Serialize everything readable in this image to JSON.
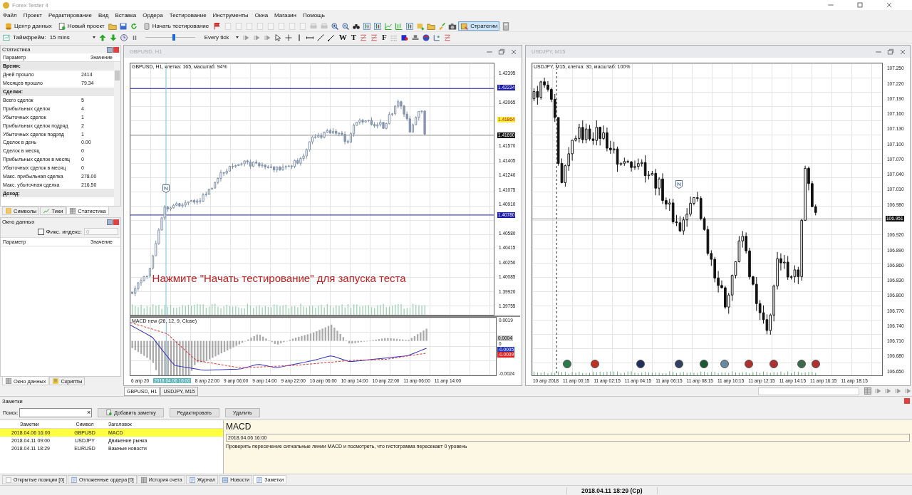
{
  "window": {
    "title": "Forex Tester 4"
  },
  "menu": [
    "Файл",
    "Проект",
    "Редактирование",
    "Вид",
    "Вставка",
    "Ордера",
    "Тестирование",
    "Инструменты",
    "Окна",
    "Магазин",
    "Помощь"
  ],
  "toolbar1": {
    "data_center": "Центр данных",
    "new_project": "Новый проект",
    "start_testing": "Начать тестирование",
    "strategies": {
      "label": "Стратегии",
      "pressed": true
    }
  },
  "toolbar2": {
    "timeframe_label": "Таймфрейм:",
    "timeframe": "15 mins",
    "speed": {
      "level": 0.58
    },
    "tick_mode": "Every tick",
    "glyph_tools": [
      "W",
      "T"
    ],
    "font_button": "F"
  },
  "statistics": {
    "title": "Статистика",
    "columns": [
      "Параметр",
      "Значение"
    ],
    "rows": [
      {
        "kind": "section",
        "label": "Время:"
      },
      {
        "kind": "row",
        "label": "Дней прошло",
        "value": "2414"
      },
      {
        "kind": "row",
        "label": "Месяцев прошло",
        "value": "79.34"
      },
      {
        "kind": "section",
        "label": "Сделки:"
      },
      {
        "kind": "row",
        "label": "Всего сделок",
        "value": "5"
      },
      {
        "kind": "row",
        "label": "Прибыльных сделок",
        "value": "4"
      },
      {
        "kind": "row",
        "label": "Убыточных сделок",
        "value": "1"
      },
      {
        "kind": "row",
        "label": "Прибыльных сделок подряд",
        "value": "2"
      },
      {
        "kind": "row",
        "label": "Убыточных сделок подряд",
        "value": "1"
      },
      {
        "kind": "row",
        "label": "Сделок в день",
        "value": "0.00"
      },
      {
        "kind": "row",
        "label": "Сделок в месяц",
        "value": "0"
      },
      {
        "kind": "row",
        "label": "Прибыльных сделок в месяц",
        "value": "0"
      },
      {
        "kind": "row",
        "label": "Убыточных сделок в месяц",
        "value": "0"
      },
      {
        "kind": "row",
        "label": "Макс. прибыльная сделка",
        "value": "278.00"
      },
      {
        "kind": "row",
        "label": "Макс. убыточная сделка",
        "value": "216.50"
      },
      {
        "kind": "section",
        "label": "Доход:"
      }
    ],
    "tabs": [
      {
        "label": "Символы",
        "selected": false
      },
      {
        "label": "Тики",
        "selected": false
      },
      {
        "label": "Статистика",
        "selected": true
      }
    ]
  },
  "data_window": {
    "title": "Окно данных",
    "fix_index": {
      "label": "Фикс. индекс:",
      "checked": false,
      "value": "0",
      "disabled": true
    },
    "columns": [
      "Параметр",
      "Значение"
    ],
    "tabs": [
      {
        "label": "Окно данных",
        "selected": true
      },
      {
        "label": "Скрипты",
        "selected": false
      }
    ]
  },
  "charts": [
    {
      "title": "GBPUSD, H1",
      "info": "GBPUSD, H1, клетка: 165, масштаб: 94%",
      "message": "Нажмите \"Начать тестирование\" для запуска теста",
      "price_ticks": [
        "1.42395",
        "1.42065",
        "1.41570",
        "1.41405",
        "1.41240",
        "1.41075",
        "1.40910",
        "1.40580",
        "1.40415",
        "1.40250",
        "1.40085",
        "1.39920",
        "1.39755"
      ],
      "price_labels": [
        {
          "text": "1.42224",
          "color": "#1a1aa8"
        },
        {
          "text": "1.41864",
          "color": "#f4f040"
        },
        {
          "text": "1.41690",
          "color": "#101010"
        },
        {
          "text": "1.40780",
          "color": "#1a1aa8"
        }
      ],
      "indicator": {
        "title": "MACD new (26, 12, 9, Close)",
        "ticks": [
          "0.0019",
          "0",
          "-0.0024"
        ],
        "labels": [
          {
            "text": "0.0004",
            "color": "#c8c8c8"
          },
          {
            "text": "-0.0005",
            "color": "#2030c0"
          },
          {
            "text": "-0.0009",
            "color": "#e02020"
          }
        ]
      },
      "time_labels": [
        {
          "text": "6 апр 20",
          "highlighted": false
        },
        {
          "text": "2018.04.06 16:00",
          "highlighted": true
        },
        {
          "text": "8 апр 22:00",
          "highlighted": false
        },
        {
          "text": "9 апр 06:00",
          "highlighted": false
        },
        {
          "text": "9 апр 14:00",
          "highlighted": false
        },
        {
          "text": "9 апр 22:00",
          "highlighted": false
        },
        {
          "text": "10 апр 06:00",
          "highlighted": false
        },
        {
          "text": "10 апр 14:00",
          "highlighted": false
        },
        {
          "text": "10 апр 22:00",
          "highlighted": false
        },
        {
          "text": "11 апр 06:00",
          "highlighted": false
        },
        {
          "text": "11 апр 14:00",
          "highlighted": false
        }
      ]
    },
    {
      "title": "USDJPY, M15",
      "info": "USDJPY, M15, клетка: 30, масштаб: 100%",
      "price_ticks": [
        "107.250",
        "107.220",
        "107.190",
        "107.160",
        "107.130",
        "107.100",
        "107.070",
        "107.040",
        "107.010",
        "106.980",
        "106.920",
        "106.890",
        "106.860",
        "106.830",
        "106.800",
        "106.770",
        "106.740",
        "106.710",
        "106.680",
        "106.650"
      ],
      "price_labels": [
        {
          "text": "106.951",
          "color": "#101010"
        }
      ],
      "time_labels": [
        {
          "text": "10 апр 2018",
          "highlighted": false
        },
        {
          "text": "11 апр 00:15",
          "highlighted": false
        },
        {
          "text": "11 апр 02:15",
          "highlighted": false
        },
        {
          "text": "11 апр 04:15",
          "highlighted": false
        },
        {
          "text": "11 апр 06:15",
          "highlighted": false
        },
        {
          "text": "11 апр 08:15",
          "highlighted": false
        },
        {
          "text": "11 апр 10:15",
          "highlighted": false
        },
        {
          "text": "11 апр 12:15",
          "highlighted": false
        },
        {
          "text": "11 апр 14:15",
          "highlighted": false
        },
        {
          "text": "11 апр 16:15",
          "highlighted": false
        },
        {
          "text": "11 апр 18:15",
          "highlighted": false
        }
      ]
    }
  ],
  "chart_tabs": [
    {
      "label": "GBPUSD, H1",
      "selected": true
    },
    {
      "label": "USDJPY, M15",
      "selected": false
    }
  ],
  "notes": {
    "title": "Заметки",
    "search_label": "Поиск:",
    "clear": "×",
    "buttons": [
      "Добавить заметку",
      "Редактировать",
      "Удалить"
    ],
    "columns": [
      "Заметки",
      "Символ",
      "Заголовок"
    ],
    "rows": [
      {
        "date": "2018.04.06 16:00",
        "symbol": "GBPUSD",
        "title": "MACD",
        "selected": true
      },
      {
        "date": "2018.04.11 09:00",
        "symbol": "USDJPY",
        "title": "Движение рынка",
        "selected": false
      },
      {
        "date": "2018.04.11 18:29",
        "symbol": "EURUSD",
        "title": "Важные новости",
        "selected": false
      }
    ],
    "detail": {
      "title": "MACD",
      "date": "2018.04.06 16:00",
      "text": "Проверить пересечение сигнальные линии MACD и посмотреть, что гистограмма пересекает 0 уровень"
    }
  },
  "bottom_tabs": [
    {
      "label": "Открытые позиции [0]",
      "selected": false
    },
    {
      "label": "Отложенные ордера [0]",
      "selected": false
    },
    {
      "label": "История счета",
      "selected": false
    },
    {
      "label": "Журнал",
      "selected": false
    },
    {
      "label": "Новости",
      "selected": false
    },
    {
      "label": "Заметки",
      "selected": true
    }
  ],
  "status_bar": {
    "datetime": "2018.04.11 18:29 (Ср)"
  }
}
